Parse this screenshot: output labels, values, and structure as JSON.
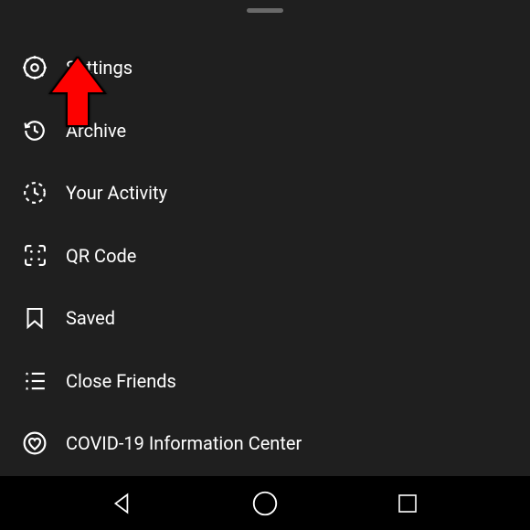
{
  "menu": {
    "items": [
      {
        "label": "Settings",
        "icon": "gear-icon"
      },
      {
        "label": "Archive",
        "icon": "history-icon"
      },
      {
        "label": "Your Activity",
        "icon": "activity-clock-icon"
      },
      {
        "label": "QR Code",
        "icon": "qr-code-icon"
      },
      {
        "label": "Saved",
        "icon": "bookmark-icon"
      },
      {
        "label": "Close Friends",
        "icon": "close-friends-icon"
      },
      {
        "label": "COVID-19 Information Center",
        "icon": "heart-circle-icon"
      }
    ]
  },
  "annotation": {
    "type": "red-arrow",
    "points_to": "Settings"
  }
}
